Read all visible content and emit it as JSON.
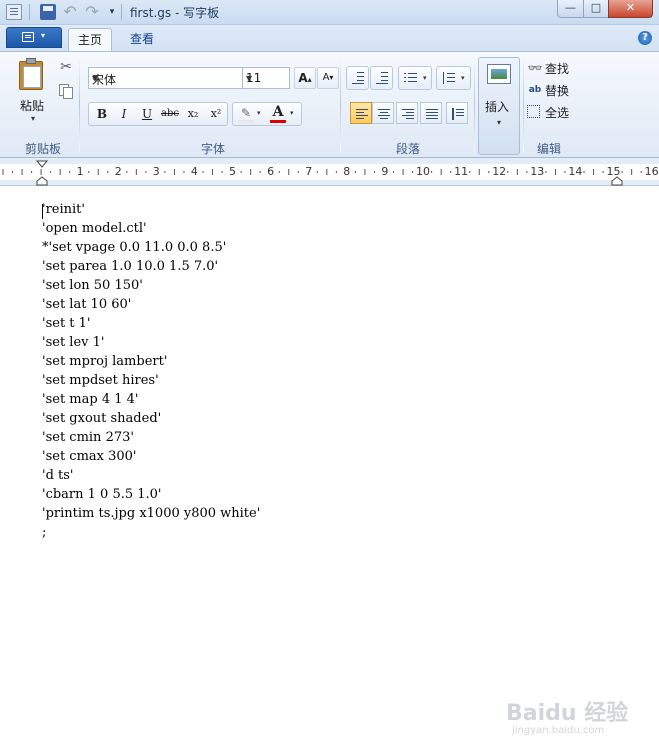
{
  "window": {
    "title": "first.gs - 写字板",
    "min_glyph": "—",
    "max_glyph": "□",
    "close_glyph": "✕"
  },
  "qat": {
    "undo_glyph": "↶",
    "redo_glyph": "↷",
    "menu_glyph": "▾"
  },
  "tabs": {
    "app_menu_arrow": "▾",
    "home": "主页",
    "view": "查看",
    "help_glyph": "?"
  },
  "clipboard": {
    "paste": "粘贴",
    "paste_arrow": "▾",
    "cut_glyph": "✂",
    "label": "剪贴板"
  },
  "font": {
    "name": "宋体",
    "size": "11",
    "grow": "A",
    "shrink": "A",
    "bold": "B",
    "italic": "I",
    "underline": "U",
    "strike": "abc",
    "subscript": "x₂",
    "superscript": "x²",
    "highlight_glyph": "✎",
    "font_color_glyph": "A",
    "label": "字体",
    "combo_arrow": "▾"
  },
  "paragraph": {
    "label": "段落",
    "arrow": "▾"
  },
  "insert": {
    "label": "插入",
    "arrow": "▾"
  },
  "editing": {
    "find": "查找",
    "replace": "替换",
    "select_all": "全选",
    "label": "编辑",
    "replace_glyph": "ab"
  },
  "ruler": {
    "numbers": [
      "1",
      "2",
      "3",
      "4",
      "5",
      "6",
      "7",
      "8",
      "9",
      "10",
      "11",
      "12",
      "13",
      "14",
      "15",
      "16"
    ]
  },
  "document": {
    "lines": [
      "'reinit'",
      "'open model.ctl'",
      "*'set vpage 0.0 11.0 0.0 8.5'",
      "'set parea 1.0 10.0 1.5 7.0'",
      "'set lon 50 150'",
      "'set lat 10 60'",
      "'set t 1'",
      "'set lev 1'",
      "'set mproj lambert'",
      "'set mpdset hires'",
      "'set map 4 1 4'",
      "'set gxout shaded'",
      "'set cmin 273'",
      "'set cmax 300'",
      "'d ts'",
      "'cbarn 1 0 5.5 1.0'",
      "'printim ts.jpg x1000 y800 white'",
      ";"
    ]
  },
  "watermark": {
    "main": "Baidu 经验",
    "sub": "jingyan.baidu.com"
  }
}
